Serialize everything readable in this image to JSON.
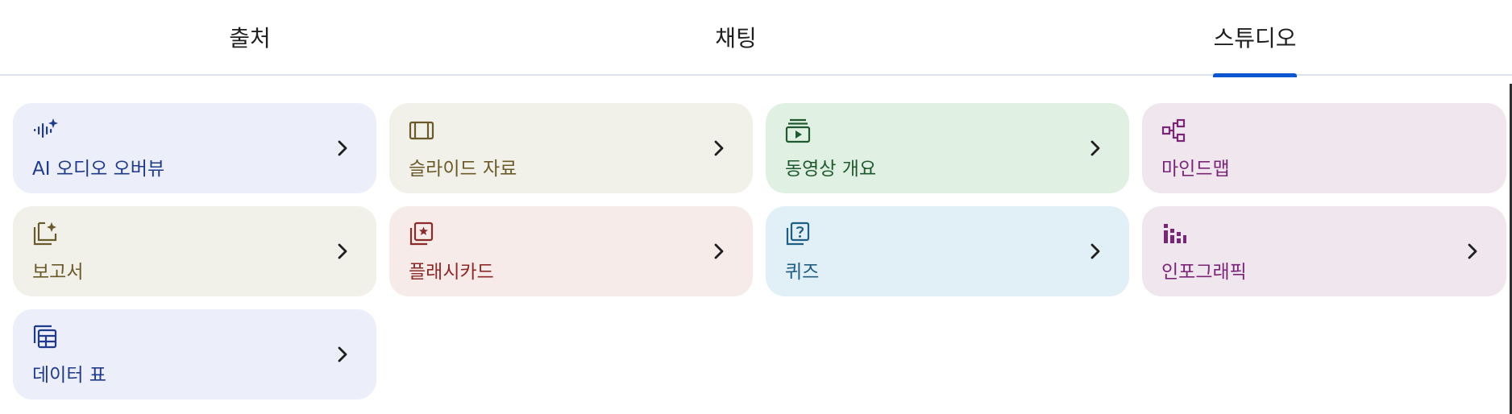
{
  "tabs": [
    {
      "label": "출처",
      "active": false
    },
    {
      "label": "채팅",
      "active": false
    },
    {
      "label": "스튜디오",
      "active": true
    }
  ],
  "studio_items": [
    {
      "label": "AI 오디오 오버뷰",
      "icon": "audio-sparkle-icon",
      "bg": "#eceff9",
      "fg": "#1f3a8a"
    },
    {
      "label": "슬라이드 자료",
      "icon": "slides-icon",
      "bg": "#f1f1ea",
      "fg": "#6a5a2a"
    },
    {
      "label": "동영상 개요",
      "icon": "video-icon",
      "bg": "#e0f1e4",
      "fg": "#1e5a2e"
    },
    {
      "label": "마인드맵",
      "icon": "mindmap-icon",
      "bg": "#f0e6ee",
      "fg": "#7a2677"
    },
    {
      "label": "보고서",
      "icon": "report-icon",
      "bg": "#f1f1ea",
      "fg": "#6a5a2a"
    },
    {
      "label": "플래시카드",
      "icon": "flashcard-icon",
      "bg": "#f6ebe8",
      "fg": "#8c2a2a"
    },
    {
      "label": "퀴즈",
      "icon": "quiz-icon",
      "bg": "#e0f0f6",
      "fg": "#1f5e82"
    },
    {
      "label": "인포그래픽",
      "icon": "infographic-icon",
      "bg": "#f0e6ee",
      "fg": "#7a2677"
    },
    {
      "label": "데이터 표",
      "icon": "data-table-icon",
      "bg": "#eceff9",
      "fg": "#1f3a8a"
    }
  ]
}
